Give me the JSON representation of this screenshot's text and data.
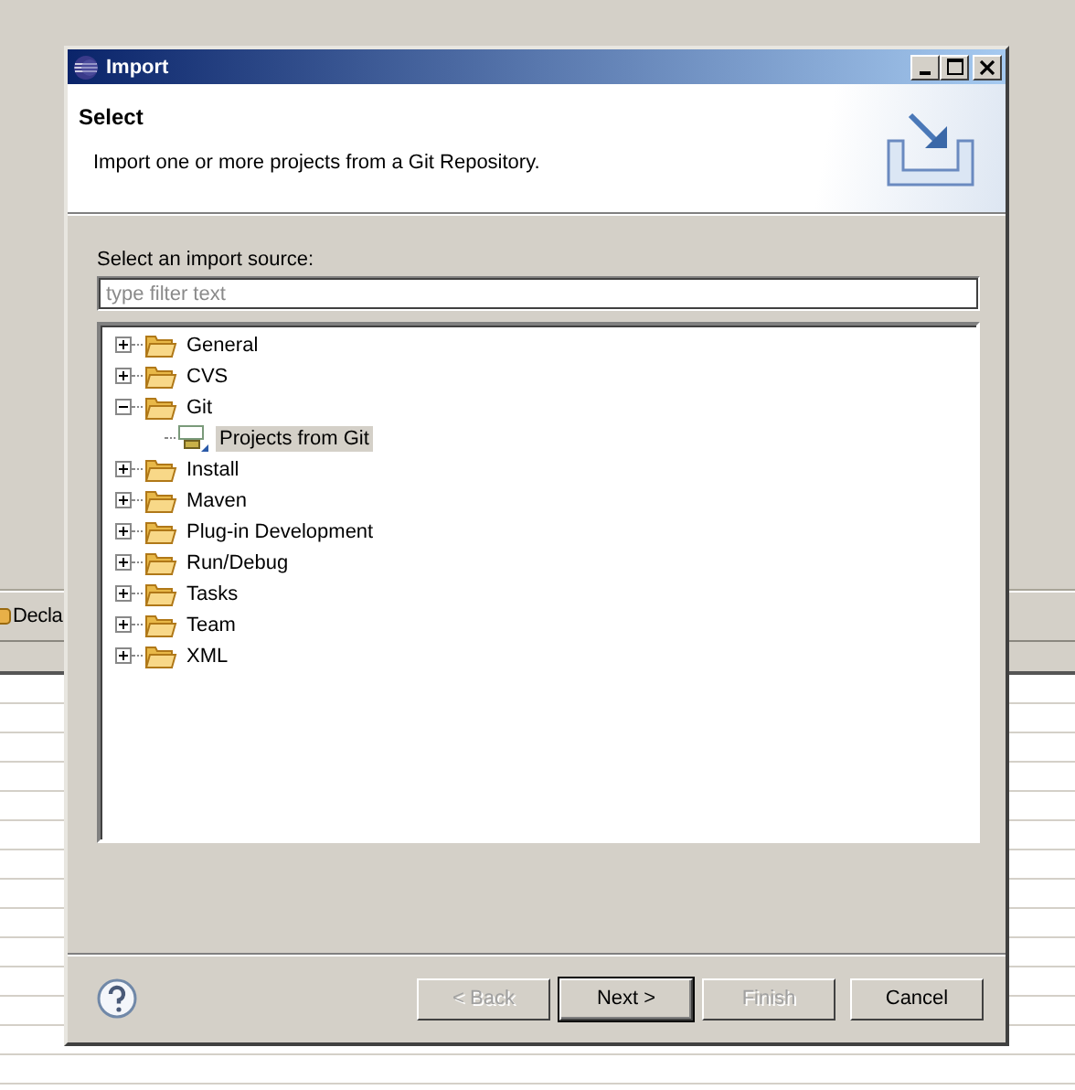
{
  "background_app": {
    "toolbar_tab": "Decla"
  },
  "dialog": {
    "title": "Import",
    "header": {
      "title": "Select",
      "message": "Import one or more projects from a Git Repository."
    },
    "source_label": "Select an import source:",
    "filter": {
      "placeholder": "type filter text"
    },
    "tree": [
      {
        "label": "General",
        "kind": "folder",
        "expanded": false
      },
      {
        "label": "CVS",
        "kind": "folder",
        "expanded": false
      },
      {
        "label": "Git",
        "kind": "folder",
        "expanded": true,
        "children": [
          {
            "label": "Projects from Git",
            "kind": "wizard",
            "selected": true
          }
        ]
      },
      {
        "label": "Install",
        "kind": "folder",
        "expanded": false
      },
      {
        "label": "Maven",
        "kind": "folder",
        "expanded": false
      },
      {
        "label": "Plug-in Development",
        "kind": "folder",
        "expanded": false
      },
      {
        "label": "Run/Debug",
        "kind": "folder",
        "expanded": false
      },
      {
        "label": "Tasks",
        "kind": "folder",
        "expanded": false
      },
      {
        "label": "Team",
        "kind": "folder",
        "expanded": false
      },
      {
        "label": "XML",
        "kind": "folder",
        "expanded": false
      }
    ],
    "buttons": [
      {
        "label": "< Back",
        "disabled": true,
        "default": false
      },
      {
        "label": "Next >",
        "disabled": false,
        "default": true
      },
      {
        "label": "Finish",
        "disabled": true,
        "default": false
      },
      {
        "label": "Cancel",
        "disabled": false,
        "default": false
      }
    ]
  }
}
